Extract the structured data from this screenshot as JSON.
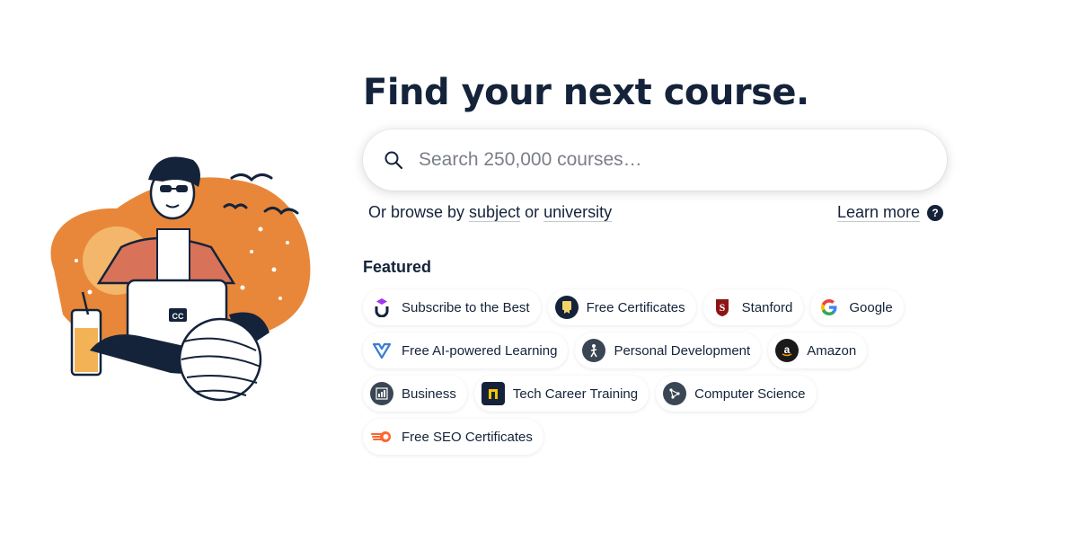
{
  "hero": {
    "title": "Find your next course.",
    "search": {
      "placeholder": "Search 250,000 courses…"
    },
    "browse": {
      "prefix": "Or browse by ",
      "subject": "subject",
      "or": " or ",
      "university": "university"
    },
    "learn_more": "Learn more",
    "help_glyph": "?"
  },
  "featured": {
    "title": "Featured",
    "chips": [
      {
        "label": "Subscribe to the Best",
        "icon": "udemy-logo-icon"
      },
      {
        "label": "Free Certificates",
        "icon": "certificate-icon"
      },
      {
        "label": "Stanford",
        "icon": "stanford-logo-icon"
      },
      {
        "label": "Google",
        "icon": "google-logo-icon"
      },
      {
        "label": "Free AI-powered Learning",
        "icon": "ai-learning-logo-icon"
      },
      {
        "label": "Personal Development",
        "icon": "hiker-icon"
      },
      {
        "label": "Amazon",
        "icon": "amazon-logo-icon"
      },
      {
        "label": "Business",
        "icon": "business-chart-icon"
      },
      {
        "label": "Tech Career Training",
        "icon": "tech-training-logo-icon"
      },
      {
        "label": "Computer Science",
        "icon": "network-icon"
      },
      {
        "label": "Free SEO Certificates",
        "icon": "semrush-logo-icon"
      }
    ]
  },
  "illustration": {
    "laptop_sticker": "CC"
  },
  "colors": {
    "text": "#14233a",
    "accent_orange": "#e8873a",
    "muted": "#7a7f87"
  }
}
